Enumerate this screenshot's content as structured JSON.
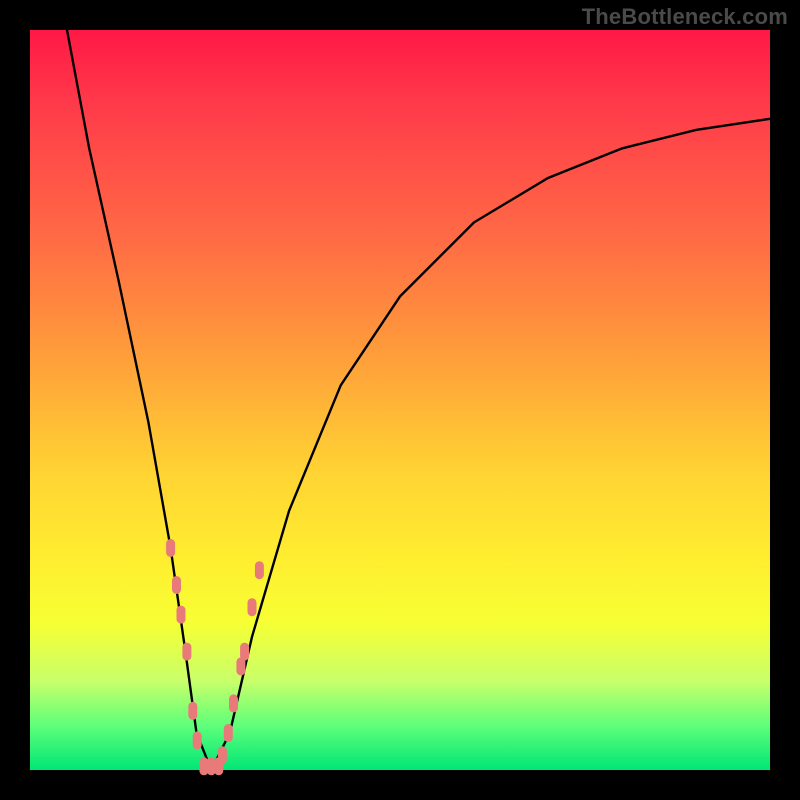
{
  "watermark": "TheBottleneck.com",
  "chart_data": {
    "type": "line",
    "title": "",
    "xlabel": "",
    "ylabel": "",
    "xlim": [
      0,
      100
    ],
    "ylim": [
      0,
      100
    ],
    "grid": false,
    "legend": false,
    "background_gradient": {
      "direction": "vertical",
      "stops": [
        {
          "pos": 0.0,
          "color": "#ff1846"
        },
        {
          "pos": 0.5,
          "color": "#ffb030"
        },
        {
          "pos": 0.8,
          "color": "#f7ff33"
        },
        {
          "pos": 1.0,
          "color": "#00e676"
        }
      ]
    },
    "series": [
      {
        "name": "bottleneck-curve",
        "x": [
          5,
          8,
          12,
          16,
          19,
          21,
          22.5,
          24.5,
          27,
          30,
          35,
          42,
          50,
          60,
          70,
          80,
          90,
          100
        ],
        "y": [
          100,
          84,
          66,
          47,
          30,
          16,
          5,
          0,
          5,
          18,
          35,
          52,
          64,
          74,
          80,
          84,
          86.5,
          88
        ]
      }
    ],
    "markers": [
      {
        "x": 19.0,
        "y": 30
      },
      {
        "x": 19.8,
        "y": 25
      },
      {
        "x": 20.4,
        "y": 21
      },
      {
        "x": 21.2,
        "y": 16
      },
      {
        "x": 22.0,
        "y": 8
      },
      {
        "x": 22.6,
        "y": 4
      },
      {
        "x": 23.5,
        "y": 0.5
      },
      {
        "x": 24.5,
        "y": 0.5
      },
      {
        "x": 25.5,
        "y": 0.5
      },
      {
        "x": 26.0,
        "y": 2
      },
      {
        "x": 26.8,
        "y": 5
      },
      {
        "x": 27.5,
        "y": 9
      },
      {
        "x": 28.5,
        "y": 14
      },
      {
        "x": 29.0,
        "y": 16
      },
      {
        "x": 30.0,
        "y": 22
      },
      {
        "x": 31.0,
        "y": 27
      }
    ],
    "marker_style": {
      "shape": "pill",
      "color": "#e87a7a",
      "size": 10
    },
    "notes": "V-shaped bottleneck curve; minimum (0% bottleneck) around x≈24. Axis tick labels are not shown in the source image, so x and y are expressed on a 0–100 normalized scale."
  }
}
